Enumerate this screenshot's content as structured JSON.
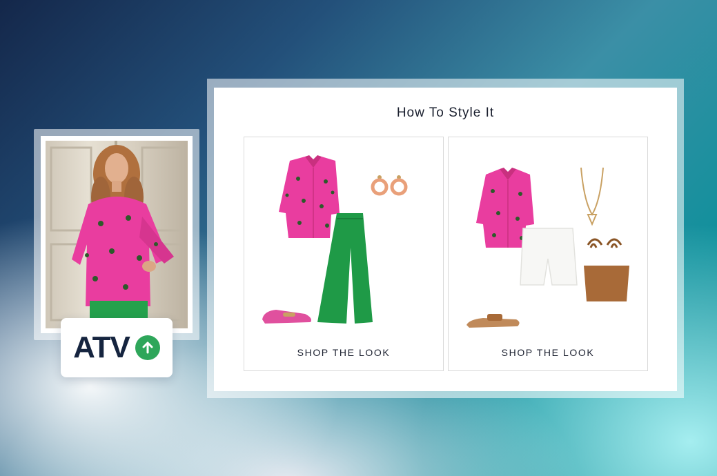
{
  "badge": {
    "text": "ATV",
    "icon": "arrow-up-circle-icon",
    "icon_color": "#2ea65a"
  },
  "panel": {
    "title": "How To Style It",
    "looks": [
      {
        "button_label": "SHOP THE LOOK",
        "items": [
          "pink-shirt",
          "earrings",
          "green-trousers",
          "pink-loafers"
        ]
      },
      {
        "button_label": "SHOP THE LOOK",
        "items": [
          "pink-shirt",
          "necklace",
          "white-shorts",
          "tan-tote-bag",
          "tan-sandals"
        ]
      }
    ]
  },
  "colors": {
    "shirt_pink": "#e93d9f",
    "trouser_green": "#1f9a47",
    "tan": "#a86a38",
    "text_dark": "#15243f"
  }
}
